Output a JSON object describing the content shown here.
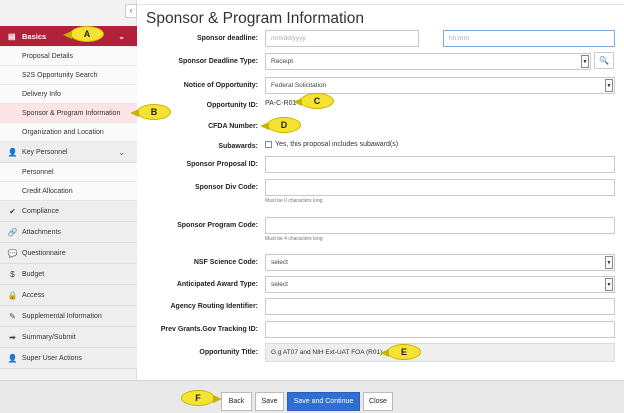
{
  "page": {
    "title": "Sponsor & Program Information"
  },
  "sidebar": {
    "collapse": "‹",
    "basics": {
      "label": "Basics",
      "icon": "document-icon",
      "chevron": "⌄"
    },
    "basics_items": [
      {
        "label": "Proposal Details"
      },
      {
        "label": "S2S Opportunity Search"
      },
      {
        "label": "Delivery Info"
      },
      {
        "label": "Sponsor & Program Information"
      },
      {
        "label": "Organization and Location"
      }
    ],
    "key_personnel": {
      "label": "Key Personnel",
      "icon": "person-icon",
      "chevron": "⌄"
    },
    "key_personnel_items": [
      {
        "label": "Personnel"
      },
      {
        "label": "Credit Allocation"
      }
    ],
    "sections": [
      {
        "label": "Compliance",
        "icon": "✔"
      },
      {
        "label": "Attachments",
        "icon": "🔗"
      },
      {
        "label": "Questionnaire",
        "icon": "💬"
      },
      {
        "label": "Budget",
        "icon": "$"
      },
      {
        "label": "Access",
        "icon": "🔒"
      },
      {
        "label": "Supplemental Information",
        "icon": "✎"
      },
      {
        "label": "Summary/Submit",
        "icon": "➡"
      },
      {
        "label": "Super User Actions",
        "icon": "👤"
      }
    ]
  },
  "form": {
    "sponsor_deadline": {
      "label": "Sponsor deadline:",
      "date_placeholder": "mm/dd/yyyy",
      "time_placeholder": "hh:mm"
    },
    "deadline_type": {
      "label": "Sponsor Deadline Type:",
      "value": "Receipt"
    },
    "notice": {
      "label": "Notice of Opportunity:",
      "value": "Federal Solicitation"
    },
    "opportunity_id": {
      "label": "Opportunity ID:",
      "value": "PA-C-R01"
    },
    "cfda": {
      "label": "CFDA Number:"
    },
    "subawards": {
      "label": "Subawards:",
      "checkbox_label": "Yes, this proposal includes subaward(s)"
    },
    "proposal_id": {
      "label": "Sponsor Proposal ID:"
    },
    "div_code": {
      "label": "Sponsor Div Code:",
      "help": "Must be 0 characters long"
    },
    "program_code": {
      "label": "Sponsor Program Code:",
      "help": "Must be 4 characters long"
    },
    "nsf_code": {
      "label": "NSF Science Code:",
      "value": "select"
    },
    "award_type": {
      "label": "Anticipated Award Type:",
      "value": "select"
    },
    "routing_id": {
      "label": "Agency Routing Identifier:"
    },
    "tracking_id": {
      "label": "Prev Grants.Gov Tracking ID:"
    },
    "opp_title": {
      "label": "Opportunity Title:",
      "value": "G.g AT07 and NIH Ext-UAT FOA (R01)"
    }
  },
  "footer": {
    "back": "Back",
    "save": "Save",
    "save_continue": "Save and Continue",
    "close": "Close"
  },
  "callouts": {
    "a": "A",
    "b": "B",
    "c": "C",
    "d": "D",
    "e": "E",
    "f": "F"
  },
  "icons": {
    "search": "🔍",
    "select_arrow": "▼"
  },
  "colors": {
    "accent": "#b1213a",
    "primary_button": "#2f6fd1",
    "callout": "#f5e233"
  }
}
